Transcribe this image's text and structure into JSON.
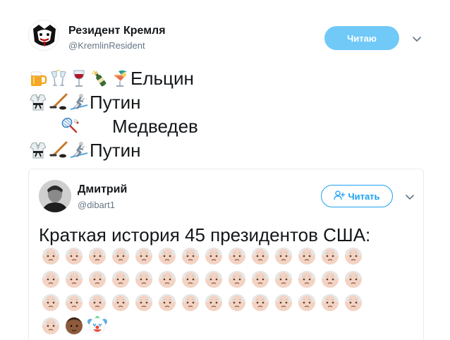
{
  "tweet": {
    "author_name": "Резидент Кремля",
    "author_handle": "@KremlinResident",
    "follow_label": "Читаю",
    "lines": [
      {
        "emojis": [
          "beer-mug",
          "clinking-glasses",
          "wine-glass",
          "champagne-bottle",
          "tropical-drink"
        ],
        "text": "Ельцин"
      },
      {
        "emojis": [
          "martial-arts-uniform",
          "ice-hockey",
          "skier"
        ],
        "text": "Путин"
      },
      {
        "emojis": [
          "badminton"
        ],
        "text": "Медведев"
      },
      {
        "emojis": [
          "martial-arts-uniform",
          "ice-hockey",
          "skier"
        ],
        "text": " Путин"
      }
    ]
  },
  "quote": {
    "author_name": "Дмитрий",
    "author_handle": "@dibart1",
    "follow_label": "Читать",
    "text": "Краткая история 45 президентов США:",
    "emoji_rows": [
      [
        "older-man-face",
        "older-man-face",
        "older-man-face",
        "older-man-face",
        "older-man-face",
        "older-man-face",
        "older-man-face",
        "older-man-face",
        "older-man-face",
        "older-man-face",
        "older-man-face",
        "older-man-face",
        "older-man-face",
        "older-man-face"
      ],
      [
        "older-man-face",
        "older-man-face",
        "older-man-face",
        "older-man-face",
        "older-man-face",
        "older-man-face",
        "older-man-face",
        "older-man-face",
        "older-man-face",
        "older-man-face",
        "older-man-face",
        "older-man-face",
        "older-man-face",
        "older-man-face"
      ],
      [
        "older-man-face",
        "older-man-face",
        "older-man-face",
        "older-man-face",
        "older-man-face",
        "older-man-face",
        "older-man-face",
        "older-man-face",
        "older-man-face",
        "older-man-face",
        "older-man-face",
        "older-man-face",
        "older-man-face",
        "older-man-face"
      ],
      [
        "older-man-face",
        "older-man-face-dark",
        "clown-face"
      ]
    ]
  },
  "colors": {
    "follow_filled_bg": "#71c9f8",
    "link_blue": "#1da1f2",
    "secondary_text": "#657786",
    "border": "#e6ecf0"
  }
}
